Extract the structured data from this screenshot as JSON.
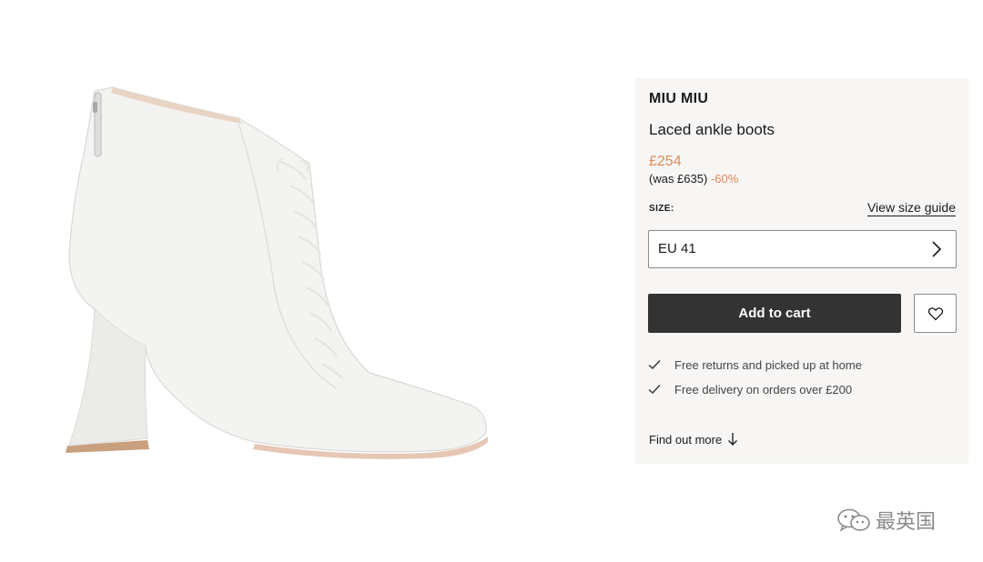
{
  "product": {
    "brand": "MIU MIU",
    "title": "Laced ankle boots",
    "price": "£254",
    "was_price": "(was £635)",
    "discount": "-60%",
    "image_icon": "white-laced-ankle-boot-image"
  },
  "size": {
    "label": "SIZE:",
    "guide_link": "View size guide",
    "selected": "EU 41"
  },
  "actions": {
    "add_to_cart": "Add to cart",
    "wishlist_icon": "heart-icon"
  },
  "benefits": [
    {
      "icon": "check-icon",
      "text": "Free returns and picked up at home"
    },
    {
      "icon": "check-icon",
      "text": "Free delivery on orders over £200"
    }
  ],
  "find_more": "Find out more",
  "watermark": {
    "text": "最英国",
    "icon": "wechat-icon"
  },
  "colors": {
    "accent_price": "#e08a5b",
    "button_dark": "#333333",
    "panel_bg": "#f7f6f4"
  }
}
